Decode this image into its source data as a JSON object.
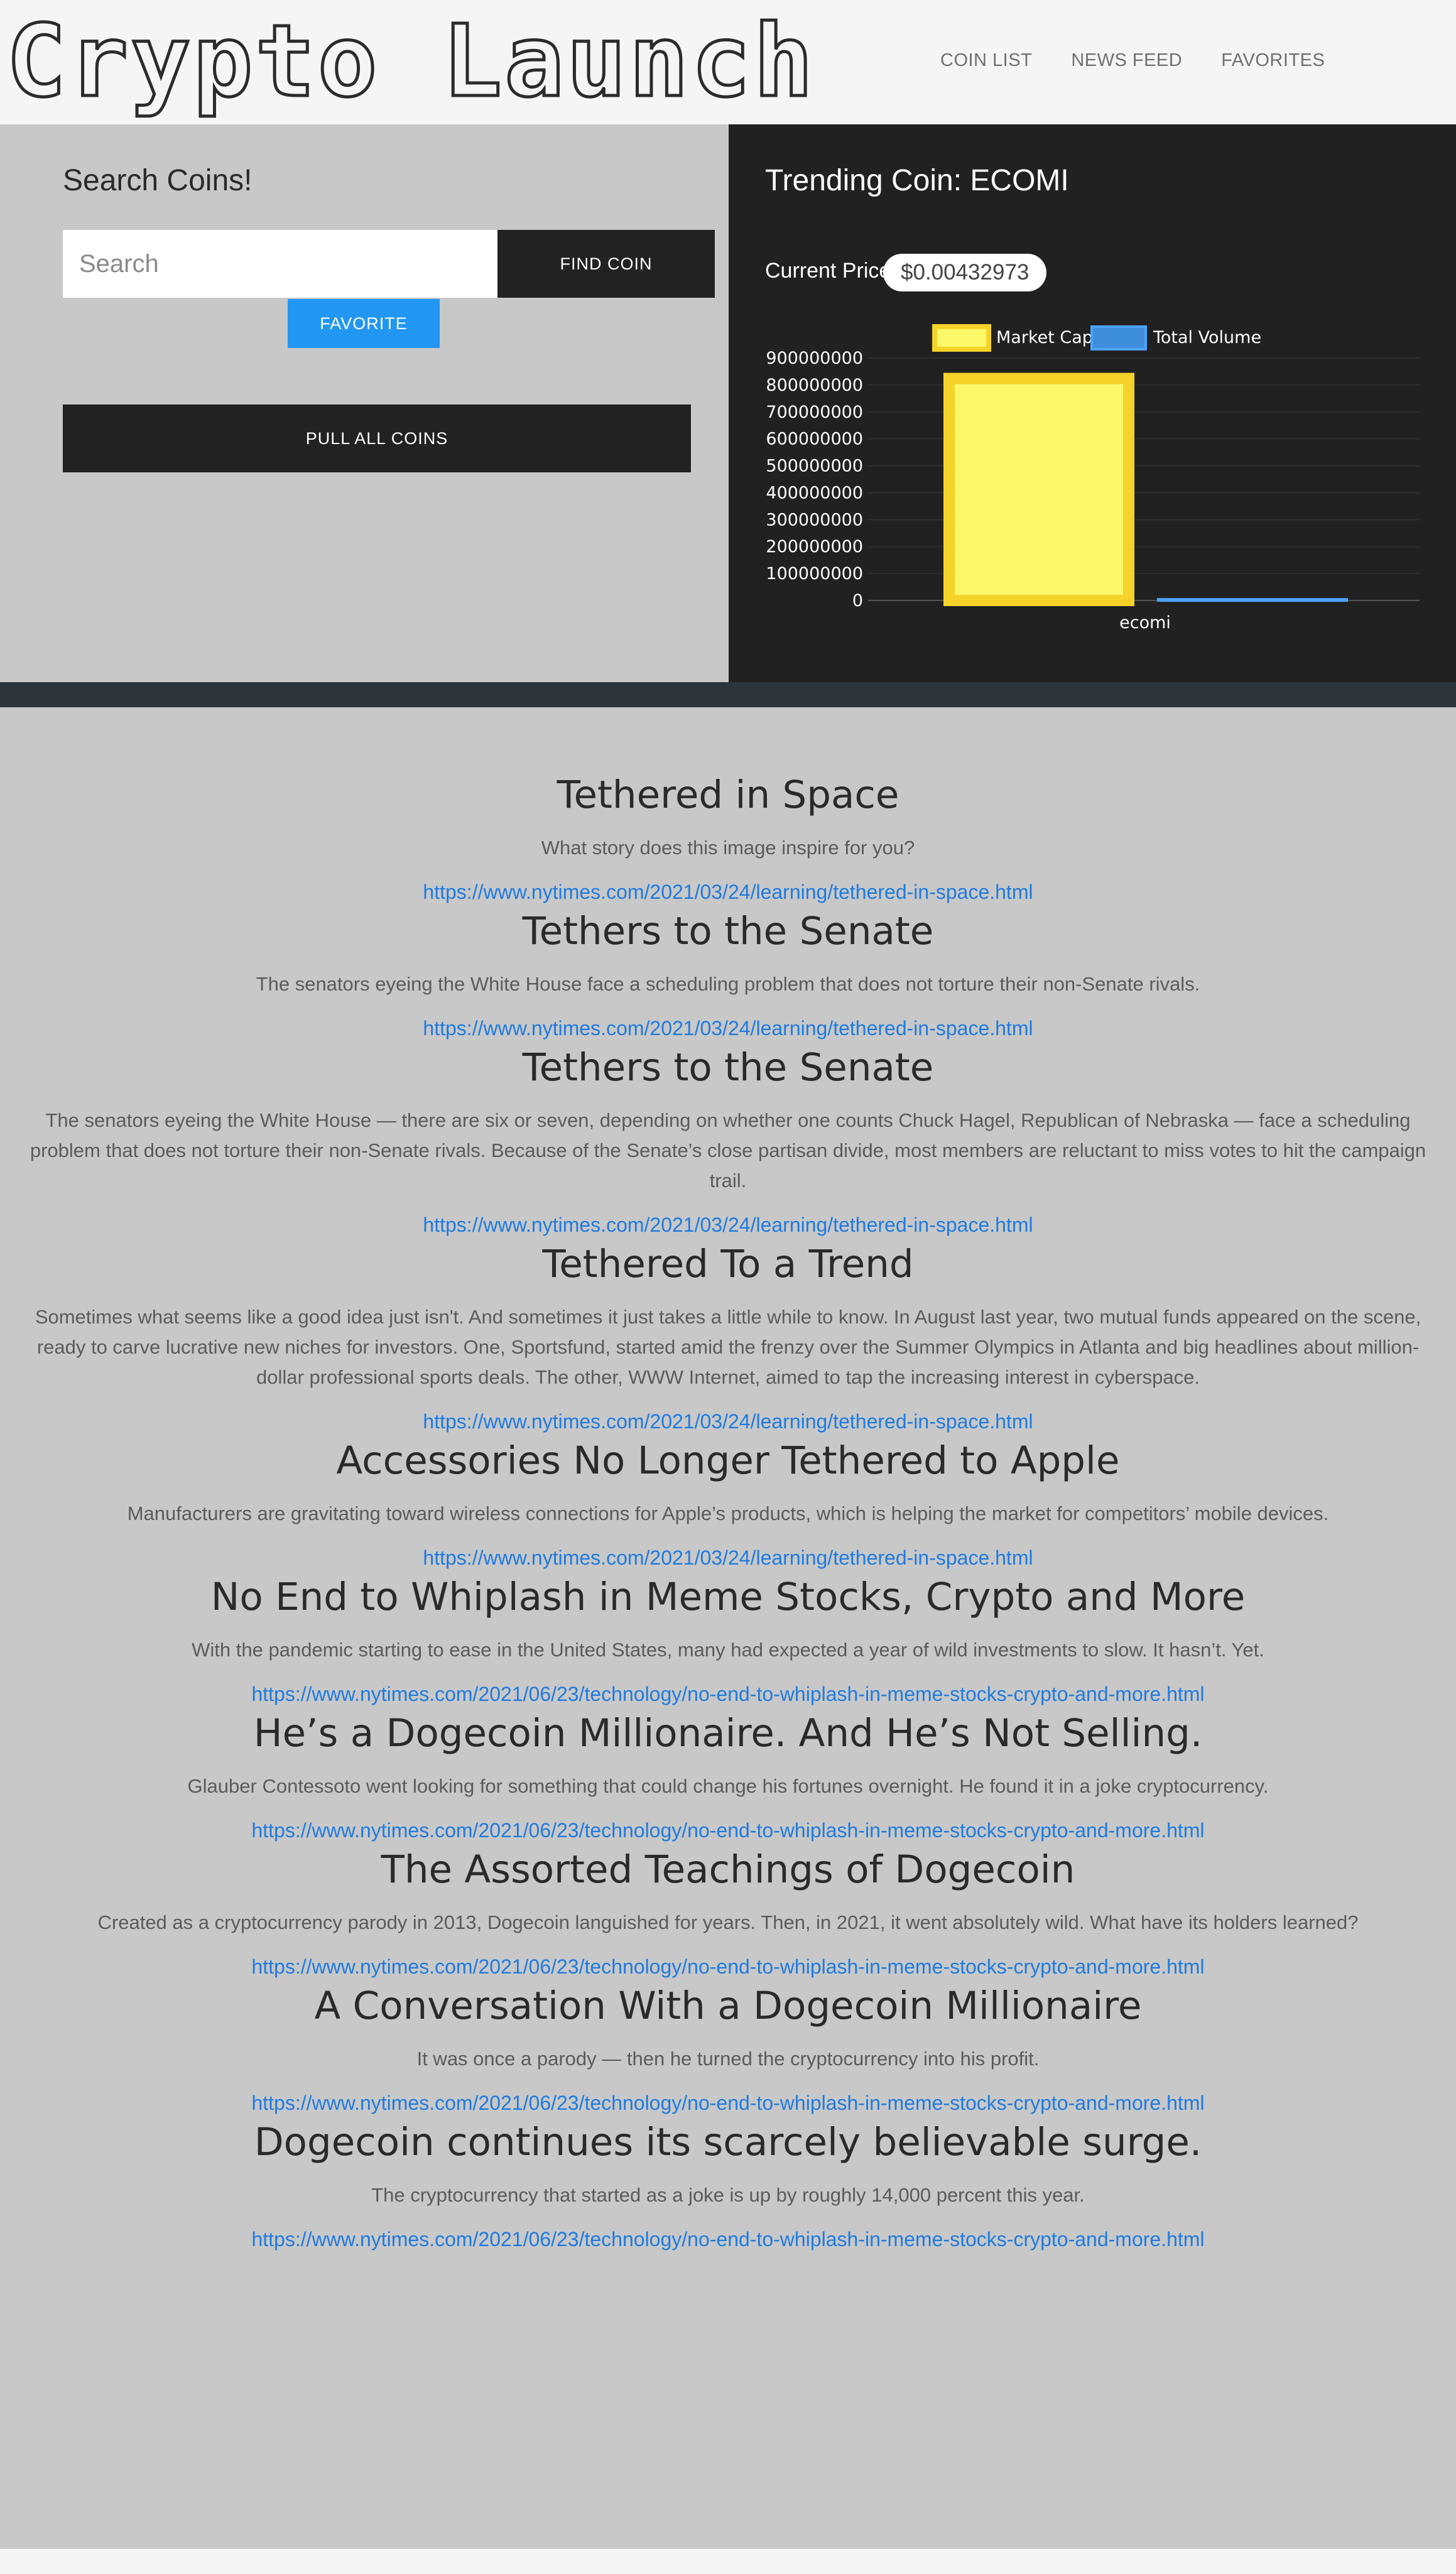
{
  "header": {
    "logo": "Crypto Launch",
    "nav": [
      "COIN LIST",
      "NEWS FEED",
      "FAVORITES"
    ]
  },
  "search_panel": {
    "title": "Search Coins!",
    "placeholder": "Search",
    "find_button": "FIND COIN",
    "favorite_button": "FAVORITE",
    "pull_button": "PULL ALL COINS"
  },
  "trending": {
    "title": "Trending Coin: ECOMI",
    "price_label": "Current Price:",
    "price_value": "$0.00432973"
  },
  "chart_data": {
    "type": "bar",
    "categories": [
      "ecomi"
    ],
    "series": [
      {
        "name": "Market Cap",
        "values": [
          845000000
        ],
        "color": "#fcf86a",
        "border": "#f5d328"
      },
      {
        "name": "Total Volume",
        "values": [
          9000000
        ],
        "color": "#3d8fdc",
        "border": "#4da3ff"
      }
    ],
    "yticks": [
      0,
      100000000,
      200000000,
      300000000,
      400000000,
      500000000,
      600000000,
      700000000,
      800000000,
      900000000
    ],
    "ylim": [
      0,
      900000000
    ],
    "legend": "top",
    "grid": true
  },
  "colors": {
    "accent": "#2196f3",
    "link": "#1f7be0",
    "dark": "#222222",
    "panel": "#c8c8c8"
  },
  "articles": [
    {
      "title": "Tethered in Space",
      "summary": "What story does this image inspire for you?",
      "url": "https://www.nytimes.com/2021/03/24/learning/tethered-in-space.html"
    },
    {
      "title": "Tethers to the Senate",
      "summary": "The senators eyeing the White House face a scheduling problem that does not torture their non-Senate rivals.",
      "url": "https://www.nytimes.com/2021/03/24/learning/tethered-in-space.html"
    },
    {
      "title": "Tethers to the Senate",
      "summary": "The senators eyeing the White House — there are six or seven, depending on whether one counts Chuck Hagel, Republican of Nebraska — face a scheduling problem that does not torture their non-Senate rivals. Because of the Senate’s close partisan divide, most members are reluctant to miss votes to hit the campaign trail.",
      "url": "https://www.nytimes.com/2021/03/24/learning/tethered-in-space.html"
    },
    {
      "title": "Tethered To a Trend",
      "summary": "Sometimes what seems like a good idea just isn't. And sometimes it just takes a little while to know. In August last year, two mutual funds appeared on the scene, ready to carve lucrative new niches for investors. One, Sportsfund, started amid the frenzy over the Summer Olympics in Atlanta and big headlines about million-dollar professional sports deals. The other, WWW Internet, aimed to tap the increasing interest in cyberspace.",
      "url": "https://www.nytimes.com/2021/03/24/learning/tethered-in-space.html"
    },
    {
      "title": "Accessories No Longer Tethered to Apple",
      "summary": "Manufacturers are gravitating toward wireless connections for Apple’s products, which is helping the market for competitors’ mobile devices.",
      "url": "https://www.nytimes.com/2021/03/24/learning/tethered-in-space.html"
    },
    {
      "title": "No End to Whiplash in Meme Stocks, Crypto and More",
      "summary": "With the pandemic starting to ease in the United States, many had expected a year of wild investments to slow. It hasn’t. Yet.",
      "url": "https://www.nytimes.com/2021/06/23/technology/no-end-to-whiplash-in-meme-stocks-crypto-and-more.html"
    },
    {
      "title": "He’s a Dogecoin Millionaire. And He’s Not Selling.",
      "summary": "Glauber Contessoto went looking for something that could change his fortunes overnight. He found it in a joke cryptocurrency.",
      "url": "https://www.nytimes.com/2021/06/23/technology/no-end-to-whiplash-in-meme-stocks-crypto-and-more.html"
    },
    {
      "title": "The Assorted Teachings of Dogecoin",
      "summary": "Created as a cryptocurrency parody in 2013, Dogecoin languished for years. Then, in 2021, it went absolutely wild. What have its holders learned?",
      "url": "https://www.nytimes.com/2021/06/23/technology/no-end-to-whiplash-in-meme-stocks-crypto-and-more.html"
    },
    {
      "title": "A Conversation With a Dogecoin Millionaire",
      "summary": "It was once a parody — then he turned the cryptocurrency into his profit.",
      "url": "https://www.nytimes.com/2021/06/23/technology/no-end-to-whiplash-in-meme-stocks-crypto-and-more.html"
    },
    {
      "title": "Dogecoin continues its scarcely believable surge.",
      "summary": "The cryptocurrency that started as a joke is up by roughly 14,000 percent this year.",
      "url": "https://www.nytimes.com/2021/06/23/technology/no-end-to-whiplash-in-meme-stocks-crypto-and-more.html"
    }
  ]
}
